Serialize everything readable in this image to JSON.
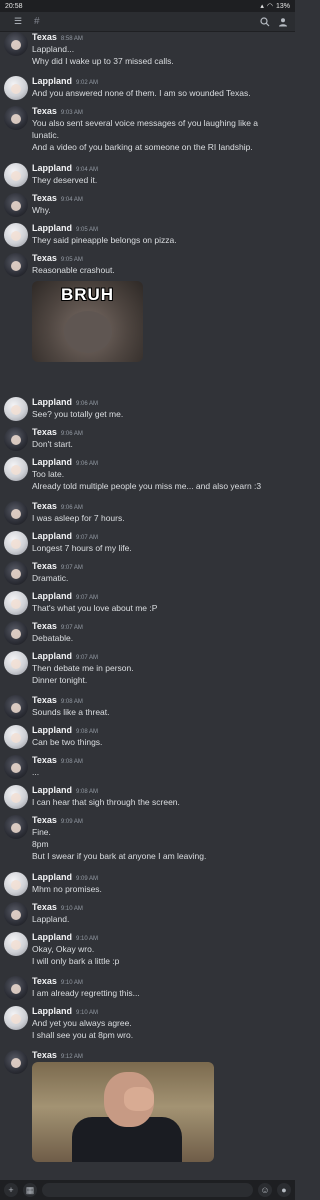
{
  "status": {
    "time": "20:58",
    "battery": "13%"
  },
  "topbar": {
    "channel_hash": "#"
  },
  "messages": [
    {
      "author": "Texas",
      "time": "8:58 AM",
      "lines": [
        "Lappland...",
        "Why did I wake up to 37 missed calls."
      ]
    },
    {
      "author": "Lappland",
      "time": "9:02 AM",
      "lines": [
        "And you answered none of them. I am so wounded Texas."
      ]
    },
    {
      "author": "Texas",
      "time": "9:03 AM",
      "lines": [
        "You also sent several voice messages of you laughing like a",
        "lunatic.",
        "And a video of you barking at someone on the RI landship."
      ]
    },
    {
      "author": "Lappland",
      "time": "9:04 AM",
      "lines": [
        "They deserved it."
      ]
    },
    {
      "author": "Texas",
      "time": "9:04 AM",
      "lines": [
        "Why."
      ]
    },
    {
      "author": "Lappland",
      "time": "9:05 AM",
      "lines": [
        "They said pineapple belongs on pizza."
      ]
    },
    {
      "author": "Texas",
      "time": "9:05 AM",
      "lines": [
        "Reasonable crashout."
      ],
      "image_caption": "BRUH"
    },
    {
      "author": "Lappland",
      "time": "9:06 AM",
      "lines": [
        "See? you totally get me."
      ]
    },
    {
      "author": "Texas",
      "time": "9:06 AM",
      "lines": [
        "Don't start."
      ]
    },
    {
      "author": "Lappland",
      "time": "9:06 AM",
      "lines": [
        "Too late.",
        "Already told multiple people you miss me... and also yearn :3"
      ]
    },
    {
      "author": "Texas",
      "time": "9:06 AM",
      "lines": [
        "I was asleep for 7 hours."
      ]
    },
    {
      "author": "Lappland",
      "time": "9:07 AM",
      "lines": [
        "Longest 7 hours of my life."
      ]
    },
    {
      "author": "Texas",
      "time": "9:07 AM",
      "lines": [
        "Dramatic."
      ]
    },
    {
      "author": "Lappland",
      "time": "9:07 AM",
      "lines": [
        "That's what you love about me :P"
      ]
    },
    {
      "author": "Texas",
      "time": "9:07 AM",
      "lines": [
        "Debatable."
      ]
    },
    {
      "author": "Lappland",
      "time": "9:07 AM",
      "lines": [
        "Then debate me in person.",
        "Dinner tonight."
      ]
    },
    {
      "author": "Texas",
      "time": "9:08 AM",
      "lines": [
        "Sounds like a threat."
      ]
    },
    {
      "author": "Lappland",
      "time": "9:08 AM",
      "lines": [
        "Can be two things."
      ]
    },
    {
      "author": "Texas",
      "time": "9:08 AM",
      "lines": [
        "..."
      ]
    },
    {
      "author": "Lappland",
      "time": "9:08 AM",
      "lines": [
        "I can hear that sigh through the screen."
      ]
    },
    {
      "author": "Texas",
      "time": "9:09 AM",
      "lines": [
        "Fine.",
        "8pm",
        "But I swear if you bark at anyone I am leaving."
      ]
    },
    {
      "author": "Lappland",
      "time": "9:09 AM",
      "lines": [
        "Mhm no promises."
      ]
    },
    {
      "author": "Texas",
      "time": "9:10 AM",
      "lines": [
        "Lappland."
      ]
    },
    {
      "author": "Lappland",
      "time": "9:10 AM",
      "lines": [
        "Okay, Okay wro.",
        "I will only bark a little :p"
      ]
    },
    {
      "author": "Texas",
      "time": "9:10 AM",
      "lines": [
        "I am already regretting this..."
      ]
    },
    {
      "author": "Lappland",
      "time": "9:10 AM",
      "lines": [
        "And yet you always agree.",
        "I shall see you at 8pm wro."
      ]
    },
    {
      "author": "Texas",
      "time": "9:12 AM",
      "lines": [],
      "has_gif": true
    }
  ]
}
